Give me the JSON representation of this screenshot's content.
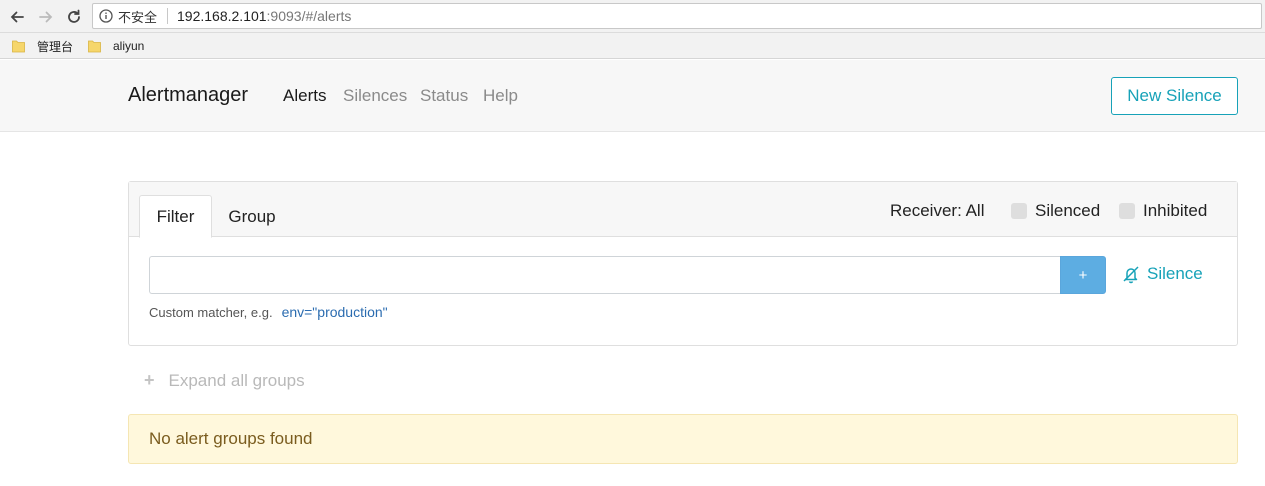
{
  "browser": {
    "security_label": "不安全",
    "url_host": "192.168.2.101",
    "url_path": ":9093/#/alerts",
    "bookmarks": [
      {
        "label": "管理台"
      },
      {
        "label": "aliyun"
      }
    ]
  },
  "navbar": {
    "brand": "Alertmanager",
    "links": [
      {
        "label": "Alerts",
        "active": true
      },
      {
        "label": "Silences"
      },
      {
        "label": "Status"
      },
      {
        "label": "Help"
      }
    ],
    "new_silence_label": "New Silence",
    "accent_color": "#17a2b8"
  },
  "filter_card": {
    "tabs": [
      {
        "label": "Filter",
        "active": true
      },
      {
        "label": "Group"
      }
    ],
    "receiver_label": "Receiver: All",
    "checkboxes": [
      {
        "label": "Silenced",
        "checked": false
      },
      {
        "label": "Inhibited",
        "checked": false
      }
    ],
    "matcher_input_value": "",
    "add_button_label": "+",
    "silence_link_label": "Silence",
    "help_prefix": "Custom matcher, e.g.",
    "help_example": "env=\"production\""
  },
  "expand_all_label": "Expand all groups",
  "alert_message": "No alert groups found",
  "icons": {
    "back": "arrow-left-icon",
    "forward": "arrow-right-icon",
    "reload": "reload-icon",
    "info": "info-icon",
    "folder": "folder-icon",
    "silence": "bell-slash-icon",
    "expand": "plus-icon"
  }
}
